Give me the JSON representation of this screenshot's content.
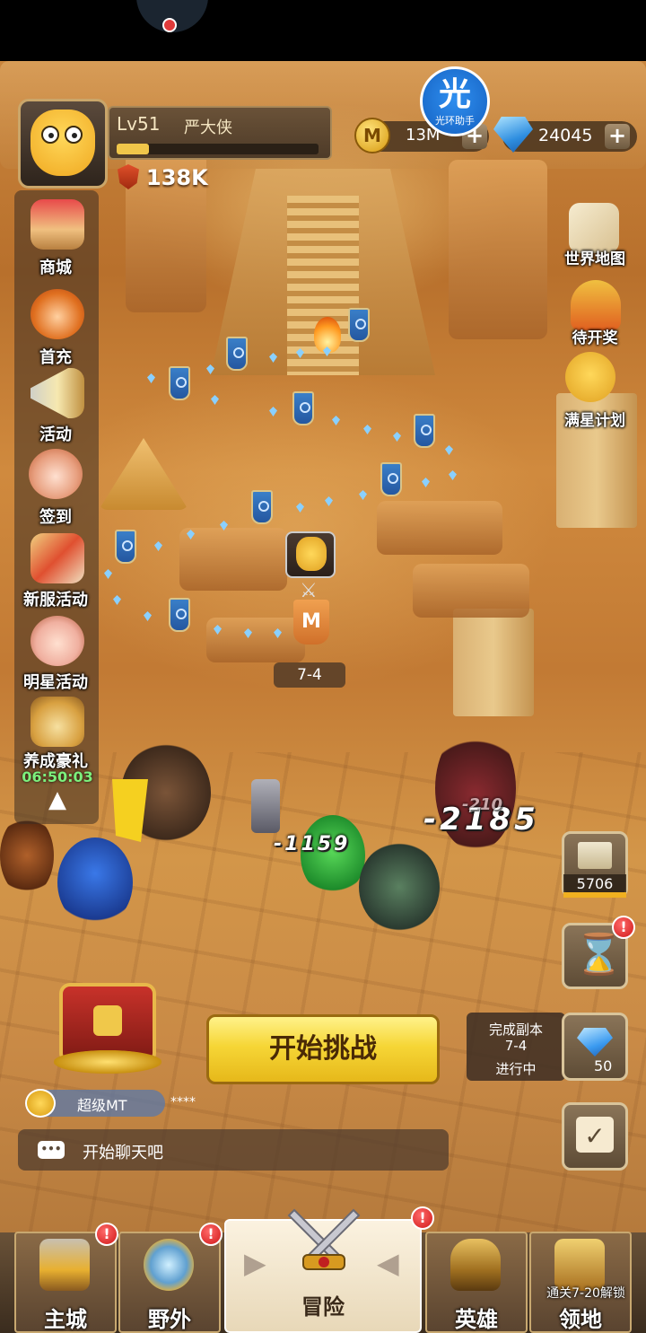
{
  "player": {
    "level": "Lv51",
    "name": "严大侠",
    "power": "138K",
    "exp_progress": 0.16
  },
  "currency": {
    "coins": "13M",
    "coin_symbol": "M",
    "gems": "24045",
    "plus": "+"
  },
  "helper": {
    "glyph": "光",
    "label": "光环助手"
  },
  "left_menu": [
    {
      "label": "商城",
      "icon": "shop-icon",
      "badge": "shop"
    },
    {
      "label": "首充",
      "icon": "first-recharge-icon"
    },
    {
      "label": "活动",
      "icon": "horn-icon"
    },
    {
      "label": "签到",
      "icon": "checkin-icon"
    },
    {
      "label": "新服活动",
      "icon": "firework-icon"
    },
    {
      "label": "明星活动",
      "icon": "star-girl-icon"
    },
    {
      "label": "养成豪礼",
      "icon": "gift-bag-icon"
    }
  ],
  "left_timer": "06:50:03",
  "right_menu": [
    {
      "label": "世界地图",
      "icon": "world-map-icon"
    },
    {
      "label": "待开奖",
      "icon": "lottery-icon"
    },
    {
      "label": "满星计划",
      "icon": "star-plan-icon"
    }
  ],
  "stage": {
    "label": "7-4",
    "flag_letter": "M"
  },
  "damage": [
    "-2185",
    "-1159",
    "-210"
  ],
  "side_buttons": {
    "book_count": "5706",
    "badge": "!"
  },
  "start_button": "开始挑战",
  "dungeon": {
    "line1": "完成副本",
    "line2": "7-4",
    "line3": "进行中",
    "reward": "50"
  },
  "chat": {
    "user": "超级MT",
    "message": "****",
    "placeholder": "开始聊天吧",
    "icon_text": "•••"
  },
  "bottom_nav": [
    {
      "label": "主城",
      "icon": "castle-icon",
      "badge": "!"
    },
    {
      "label": "野外",
      "icon": "field-icon",
      "badge": "!"
    },
    {
      "label": "冒险",
      "icon": "crossed-swords-icon",
      "badge": "!",
      "active": true
    },
    {
      "label": "英雄",
      "icon": "helmet-icon"
    },
    {
      "label": "领地",
      "icon": "territory-icon",
      "lock_text": "通关7-20解锁"
    }
  ],
  "chevron_left": "▶",
  "chevron_right": "◀",
  "colors": {
    "accent": "#f6d636",
    "badge": "#d01818",
    "gem": "#3a9af0",
    "timer": "#7cf07c"
  }
}
